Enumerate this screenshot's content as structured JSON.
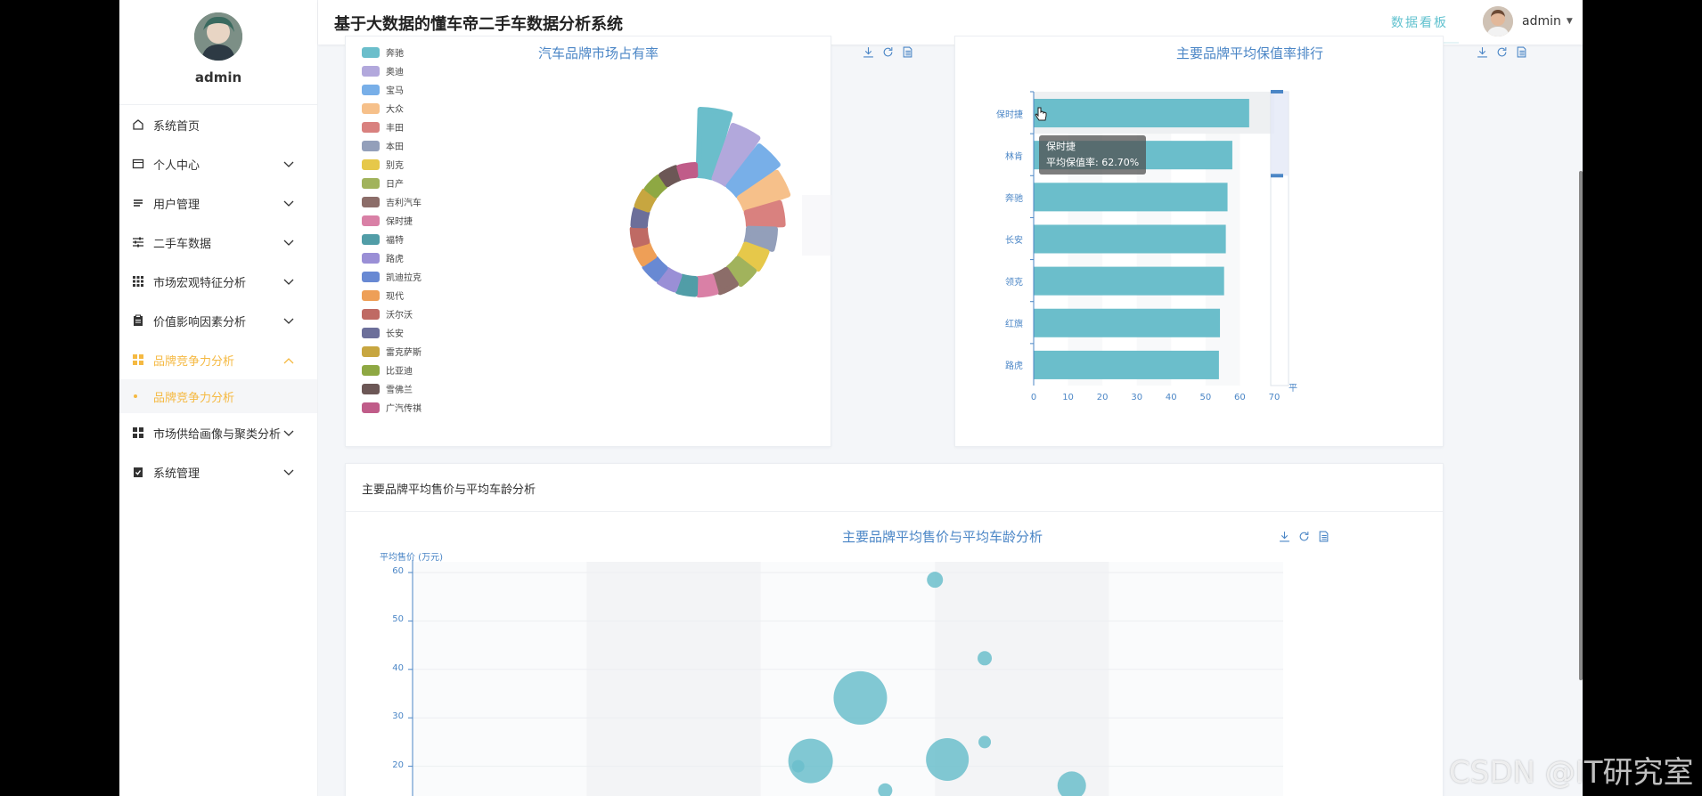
{
  "app": {
    "system_title": "基于大数据的懂车帝二手车数据分析系统",
    "dashboard_link": "数据看板",
    "user_name": "admin"
  },
  "sidebar": {
    "user": "admin",
    "items": [
      {
        "label": "系统首页",
        "icon": "home-icon",
        "expandable": false
      },
      {
        "label": "个人中心",
        "icon": "card-icon",
        "expandable": true
      },
      {
        "label": "用户管理",
        "icon": "list-icon",
        "expandable": true
      },
      {
        "label": "二手车数据",
        "icon": "sliders-icon",
        "expandable": true
      },
      {
        "label": "市场宏观特征分析",
        "icon": "grid-icon",
        "expandable": true
      },
      {
        "label": "价值影响因素分析",
        "icon": "clipboard-icon",
        "expandable": true
      },
      {
        "label": "品牌竞争力分析",
        "icon": "apps-icon",
        "expandable": true,
        "active": true
      },
      {
        "label": "市场供给画像与聚类分析",
        "icon": "apps-icon",
        "expandable": true
      },
      {
        "label": "系统管理",
        "icon": "clipboard-check-icon",
        "expandable": true
      }
    ],
    "active_sub": "品牌竞争力分析"
  },
  "colors": {
    "accent": "#f5b942",
    "teal": "#6bbecb",
    "title_blue": "#4b86c6"
  },
  "pie_chart": {
    "title": "汽车品牌市场占有率",
    "legend": [
      "奔驰",
      "奥迪",
      "宝马",
      "大众",
      "丰田",
      "本田",
      "别克",
      "日产",
      "吉利汽车",
      "保时捷",
      "福特",
      "路虎",
      "凯迪拉克",
      "现代",
      "沃尔沃",
      "长安",
      "雷克萨斯",
      "比亚迪",
      "雪佛兰",
      "广汽传祺"
    ]
  },
  "bar_chart": {
    "title": "主要品牌平均保值率排行",
    "tooltip_name": "保时捷",
    "tooltip_value": "平均保值率: 62.70%",
    "dataZoom_label": "平"
  },
  "section": {
    "title": "主要品牌平均售价与平均车龄分析"
  },
  "bubble_chart": {
    "title": "主要品牌平均售价与平均车龄分析",
    "ylabel": "平均售价 (万元)"
  },
  "watermark": "CSDN @IT研究室",
  "chart_data": [
    {
      "type": "pie",
      "title": "汽车品牌市场占有率",
      "rose": true,
      "categories": [
        "奔驰",
        "奥迪",
        "宝马",
        "大众",
        "丰田",
        "本田",
        "别克",
        "日产",
        "吉利汽车",
        "保时捷",
        "福特",
        "路虎",
        "凯迪拉克",
        "现代",
        "沃尔沃",
        "长安",
        "雷克萨斯",
        "比亚迪",
        "雪佛兰",
        "广汽传祺"
      ],
      "values": [
        100,
        86,
        78,
        70,
        55,
        44,
        38,
        35,
        31,
        29,
        28,
        27,
        26,
        25,
        24,
        23,
        23,
        22,
        22,
        21
      ],
      "colors": [
        "#6bbecb",
        "#b2a8dc",
        "#78afe8",
        "#f6c08a",
        "#d9817f",
        "#939fba",
        "#e6c84a",
        "#a1b35c",
        "#8c6d69",
        "#d980a6",
        "#519da7",
        "#9a8fd6",
        "#6889d3",
        "#ee9f57",
        "#bf6a64",
        "#6c6f9a",
        "#c7a640",
        "#8ea843",
        "#6c5756",
        "#c05c89"
      ],
      "legend_position": "left"
    },
    {
      "type": "bar",
      "title": "主要品牌平均保值率排行",
      "orientation": "horizontal",
      "categories": [
        "保时捷",
        "林肯",
        "奔驰",
        "长安",
        "领克",
        "红旗",
        "路虎"
      ],
      "values": [
        62.7,
        57.8,
        56.4,
        55.9,
        55.4,
        54.2,
        53.9
      ],
      "xlim": [
        0,
        70
      ],
      "xticks": [
        0,
        10,
        20,
        30,
        40,
        50,
        60,
        70
      ],
      "highlight": "保时捷"
    },
    {
      "type": "scatter",
      "title": "主要品牌平均售价与平均车龄分析",
      "ylabel": "平均售价 (万元)",
      "ylim": [
        10,
        60
      ],
      "yticks": [
        20,
        30,
        40,
        50,
        60
      ],
      "points": [
        {
          "x": 7.2,
          "y": 58.5,
          "size": 9
        },
        {
          "x": 7.6,
          "y": 42.3,
          "size": 8
        },
        {
          "x": 6.6,
          "y": 34.1,
          "size": 30
        },
        {
          "x": 7.6,
          "y": 25.0,
          "size": 7
        },
        {
          "x": 6.2,
          "y": 21.1,
          "size": 25
        },
        {
          "x": 7.3,
          "y": 21.4,
          "size": 24
        },
        {
          "x": 6.1,
          "y": 20.0,
          "size": 7
        },
        {
          "x": 8.3,
          "y": 16.0,
          "size": 16
        },
        {
          "x": 6.8,
          "y": 15.0,
          "size": 8
        }
      ]
    }
  ]
}
